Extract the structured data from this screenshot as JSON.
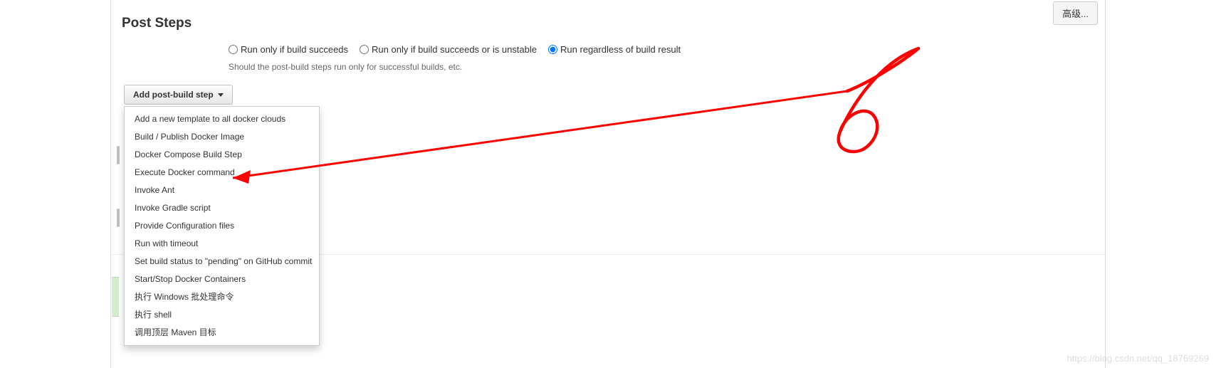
{
  "buttons": {
    "advanced": "高级...",
    "add_post_build_step": "Add post-build step"
  },
  "section": {
    "title": "Post Steps",
    "help": "Should the post-build steps run only for successful builds, etc."
  },
  "radios": {
    "succeeds": "Run only if build succeeds",
    "succeeds_or_unstable": "Run only if build succeeds or is unstable",
    "regardless": "Run regardless of build result",
    "selected": "regardless"
  },
  "dropdown": {
    "items": [
      "Add a new template to all docker clouds",
      "Build / Publish Docker Image",
      "Docker Compose Build Step",
      "Execute Docker command",
      "Invoke Ant",
      "Invoke Gradle script",
      "Provide Configuration files",
      "Run with timeout",
      "Set build status to \"pending\" on GitHub commit",
      "Start/Stop Docker Containers",
      "执行 Windows 批处理命令",
      "执行 shell",
      "调用顶层 Maven 目标"
    ]
  },
  "watermark": "https://blog.csdn.net/qq_18769269"
}
